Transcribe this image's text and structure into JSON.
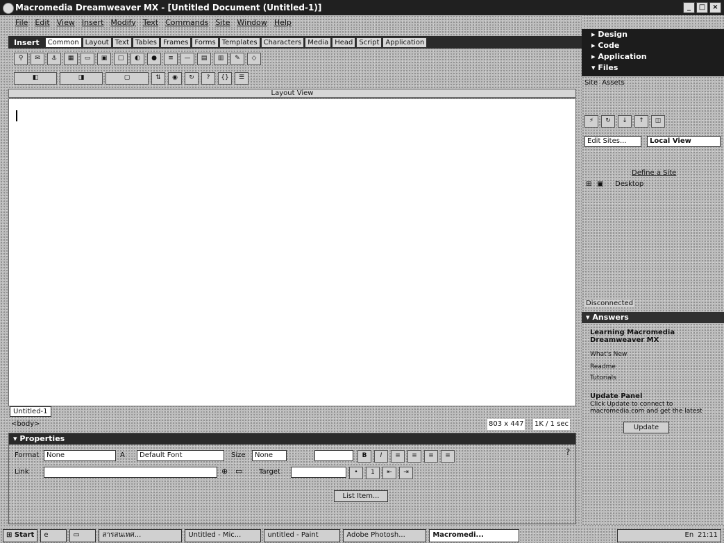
{
  "window": {
    "title": "Macromedia Dreamweaver MX - [Untitled Document (Untitled-1)]",
    "buttons": [
      "_",
      "□",
      "×"
    ]
  },
  "menu": [
    "File",
    "Edit",
    "View",
    "Insert",
    "Modify",
    "Text",
    "Commands",
    "Site",
    "Window",
    "Help"
  ],
  "insert": {
    "label": "Insert",
    "tabs": [
      "Common",
      "Layout",
      "Text",
      "Tables",
      "Frames",
      "Forms",
      "Templates",
      "Characters",
      "Media",
      "Head",
      "Script",
      "Application"
    ],
    "layout_view_label": "Layout View"
  },
  "document": {
    "tab": "Untitled-1",
    "status_tag": "<body>",
    "status_size": "803 x 447",
    "status_info": "1K / 1 sec"
  },
  "properties": {
    "header": "Properties",
    "format_label": "Format",
    "format_value": "None",
    "font_label": "A",
    "font_value": "Default Font",
    "size_label": "Size",
    "size_value": "None",
    "link_label": "Link",
    "target_label": "Target",
    "list_item_button": "List Item..."
  },
  "right_panel": {
    "sections": [
      "Design",
      "Code",
      "Application",
      "Files"
    ],
    "files": {
      "tabs": [
        "Site",
        "Assets"
      ],
      "edit_sites": "Edit Sites...",
      "view_select": "Local View",
      "define_site": "Define a Site",
      "tree_root": "Desktop",
      "status": "Disconnected"
    },
    "answers": {
      "header": "Answers",
      "heading": "Learning Macromedia Dreamweaver MX",
      "links": [
        "What's New",
        "Readme",
        "Tutorials"
      ],
      "update_title": "Update Panel",
      "update_text": "Click Update to connect to macromedia.com and get the latest",
      "update_button": "Update"
    }
  },
  "taskbar": {
    "start": "Start",
    "items": [
      "สารสนเทศ...",
      "Untitled - Mic...",
      "untitled - Paint",
      "Adobe Photosh...",
      "Macromedi..."
    ],
    "lang": "En",
    "clock": "21:11"
  }
}
